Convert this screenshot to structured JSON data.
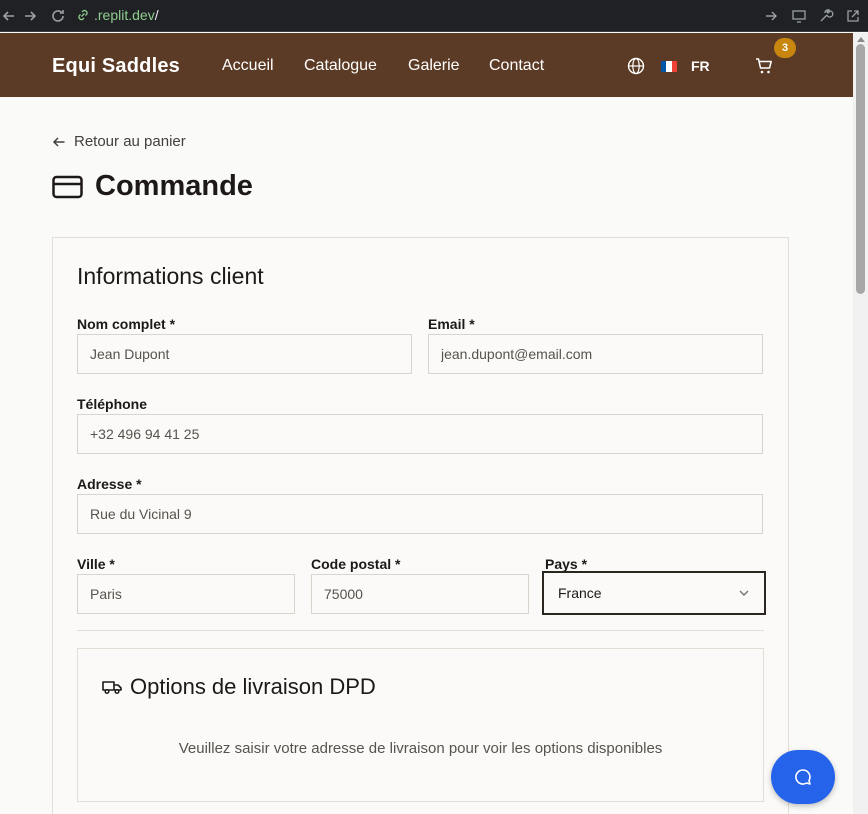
{
  "browser": {
    "url_domain": ".replit.dev",
    "url_path": "/"
  },
  "header": {
    "brand": "Equi Saddles",
    "nav": [
      {
        "label": "Accueil"
      },
      {
        "label": "Catalogue"
      },
      {
        "label": "Galerie"
      },
      {
        "label": "Contact"
      }
    ],
    "language": "FR",
    "cart_count": "3",
    "bg_color": "#5c3b26",
    "badge_color": "#c8860f"
  },
  "page": {
    "back_label": "Retour au panier",
    "title": "Commande"
  },
  "customer_form": {
    "title": "Informations client",
    "full_name": {
      "label": "Nom complet *",
      "value": "Jean Dupont"
    },
    "email": {
      "label": "Email *",
      "value": "jean.dupont@email.com"
    },
    "phone": {
      "label": "Téléphone",
      "value": "+32 496 94 41 25"
    },
    "address": {
      "label": "Adresse *",
      "value": "Rue du Vicinal 9"
    },
    "city": {
      "label": "Ville *",
      "value": "Paris"
    },
    "postal_code": {
      "label": "Code postal *",
      "value": "75000"
    },
    "country": {
      "label": "Pays *",
      "selected": "France"
    }
  },
  "shipping": {
    "title": "Options de livraison DPD",
    "note": "Veuillez saisir votre adresse de livraison pour voir les options disponibles"
  },
  "chat": {
    "accent": "#2563eb"
  }
}
